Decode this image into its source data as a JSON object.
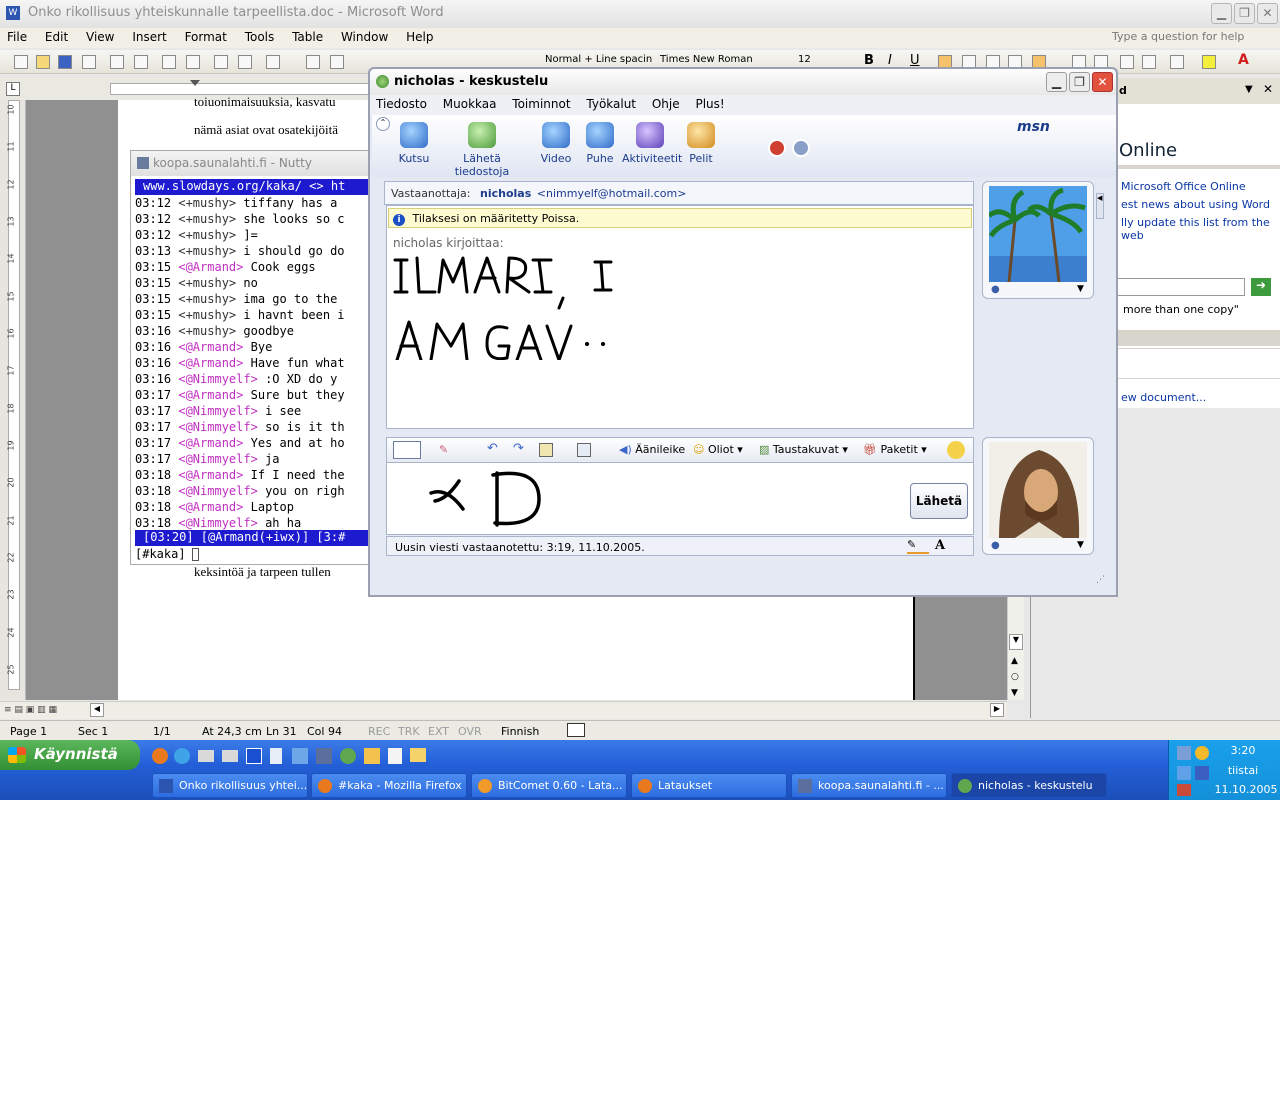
{
  "word": {
    "title": "Onko rikollisuus yhteiskunnalle tarpeellista.doc - Microsoft Word",
    "menu": [
      "File",
      "Edit",
      "View",
      "Insert",
      "Format",
      "Tools",
      "Table",
      "Window",
      "Help"
    ],
    "help_placeholder": "Type a question for help",
    "style": "Normal + Line spacin",
    "font": "Times New Roman",
    "size": "12",
    "doc_line1": "toiuonimaisuuksia, kasvatu",
    "doc_line2": "nämä asiat ovat osatekijöitä",
    "doc_line3": "keksintöä ja tarpeen tullen",
    "ruler_numbers": [
      "10",
      "11",
      "12",
      "13",
      "14",
      "15",
      "16",
      "17",
      "18",
      "19",
      "20",
      "21",
      "22",
      "23",
      "24",
      "25"
    ],
    "status": {
      "page": "Page 1",
      "sec": "Sec 1",
      "pages": "1/1",
      "at": "At 24,3 cm",
      "ln": "Ln 31",
      "col": "Col 94",
      "rec": "REC",
      "trk": "TRK",
      "ext": "EXT",
      "ovr": "OVR",
      "lang": "Finnish"
    }
  },
  "taskpane": {
    "title": "d",
    "online": "Online",
    "link1": "Microsoft Office Online",
    "link2": "est news about using Word",
    "link3": "lly update this list from the web",
    "search_hint": "more than one copy\"",
    "link4": "ew document..."
  },
  "nutty": {
    "title": "koopa.saunalahti.fi - Nutty",
    "topic": "www.slowdays.org/kaka/ <> ht",
    "lines": [
      {
        "time": "03:12",
        "nick": "<+mushy>",
        "text": "tiffany has a",
        "kind": "m"
      },
      {
        "time": "03:12",
        "nick": "<+mushy>",
        "text": "she looks so c",
        "kind": "m"
      },
      {
        "time": "03:12",
        "nick": "<+mushy>",
        "text": "]=",
        "kind": "m"
      },
      {
        "time": "03:13",
        "nick": "<+mushy>",
        "text": "i should go do",
        "kind": "m"
      },
      {
        "time": "03:15",
        "nick": "<@Armand>",
        "text": "Cook eggs",
        "kind": "a"
      },
      {
        "time": "03:15",
        "nick": "<+mushy>",
        "text": "no",
        "kind": "m"
      },
      {
        "time": "03:15",
        "nick": "<+mushy>",
        "text": "ima go to the",
        "kind": "m"
      },
      {
        "time": "03:15",
        "nick": "<+mushy>",
        "text": "i havnt been i",
        "kind": "m"
      },
      {
        "time": "03:16",
        "nick": "<+mushy>",
        "text": "goodbye",
        "kind": "m"
      },
      {
        "time": "03:16",
        "nick": "<@Armand>",
        "text": "Bye",
        "kind": "a"
      },
      {
        "time": "03:16",
        "nick": "<@Armand>",
        "text": "Have fun what",
        "kind": "a"
      },
      {
        "time": "03:16",
        "nick": "<@Nimmyelf>",
        "text": " :O XD do y",
        "kind": "a"
      },
      {
        "time": "03:17",
        "nick": "<@Armand>",
        "text": "Sure but they",
        "kind": "a"
      },
      {
        "time": "03:17",
        "nick": "<@Nimmyelf>",
        "text": "i see",
        "kind": "a"
      },
      {
        "time": "03:17",
        "nick": "<@Nimmyelf>",
        "text": "so is it th",
        "kind": "a"
      },
      {
        "time": "03:17",
        "nick": "<@Armand>",
        "text": "Yes and at ho",
        "kind": "a"
      },
      {
        "time": "03:17",
        "nick": "<@Nimmyelf>",
        "text": "ja",
        "kind": "a"
      },
      {
        "time": "03:18",
        "nick": "<@Armand>",
        "text": "If I need the",
        "kind": "a"
      },
      {
        "time": "03:18",
        "nick": "<@Nimmyelf>",
        "text": "you on righ",
        "kind": "a"
      },
      {
        "time": "03:18",
        "nick": "<@Armand>",
        "text": "Laptop",
        "kind": "a"
      },
      {
        "time": "03:18",
        "nick": "<@Nimmyelf>",
        "text": "ah ha",
        "kind": "a"
      }
    ],
    "status": "[03:20] [@Armand(+iwx)] [3:#",
    "input": "[#kaka]"
  },
  "msn": {
    "title": "nicholas - keskustelu",
    "menu": [
      "Tiedosto",
      "Muokkaa",
      "Toiminnot",
      "Työkalut",
      "Ohje",
      "Plus!"
    ],
    "toolbar": [
      "Kutsu",
      "Lähetä tiedostoja",
      "Video",
      "Puhe",
      "Aktiviteetit",
      "Pelit"
    ],
    "brand": "msn",
    "to_label": "Vastaanottaja:",
    "to_name": "nicholas",
    "to_email": "<nimmyelf@hotmail.com>",
    "info": "Tilaksesi on määritetty Poissa.",
    "writes": "nicholas kirjoittaa:",
    "ink_message": "ILMARI, I AM GAY :(",
    "compose_tools": [
      "Äänileike",
      "Oliot",
      "Taustakuvat",
      "Paketit"
    ],
    "send": "Lähetä",
    "status": "Uusin viesti vastaanotettu: 3:19, 11.10.2005."
  },
  "taskbar": {
    "start": "Käynnistä",
    "tasks": [
      "Onko rikollisuus yhtei...",
      "#kaka - Mozilla Firefox",
      "BitComet 0.60 - Lata...",
      "Lataukset",
      "koopa.saunalahti.fi - ...",
      "nicholas - keskustelu"
    ],
    "time": "3:20",
    "day": "tiistai",
    "date": "11.10.2005"
  }
}
